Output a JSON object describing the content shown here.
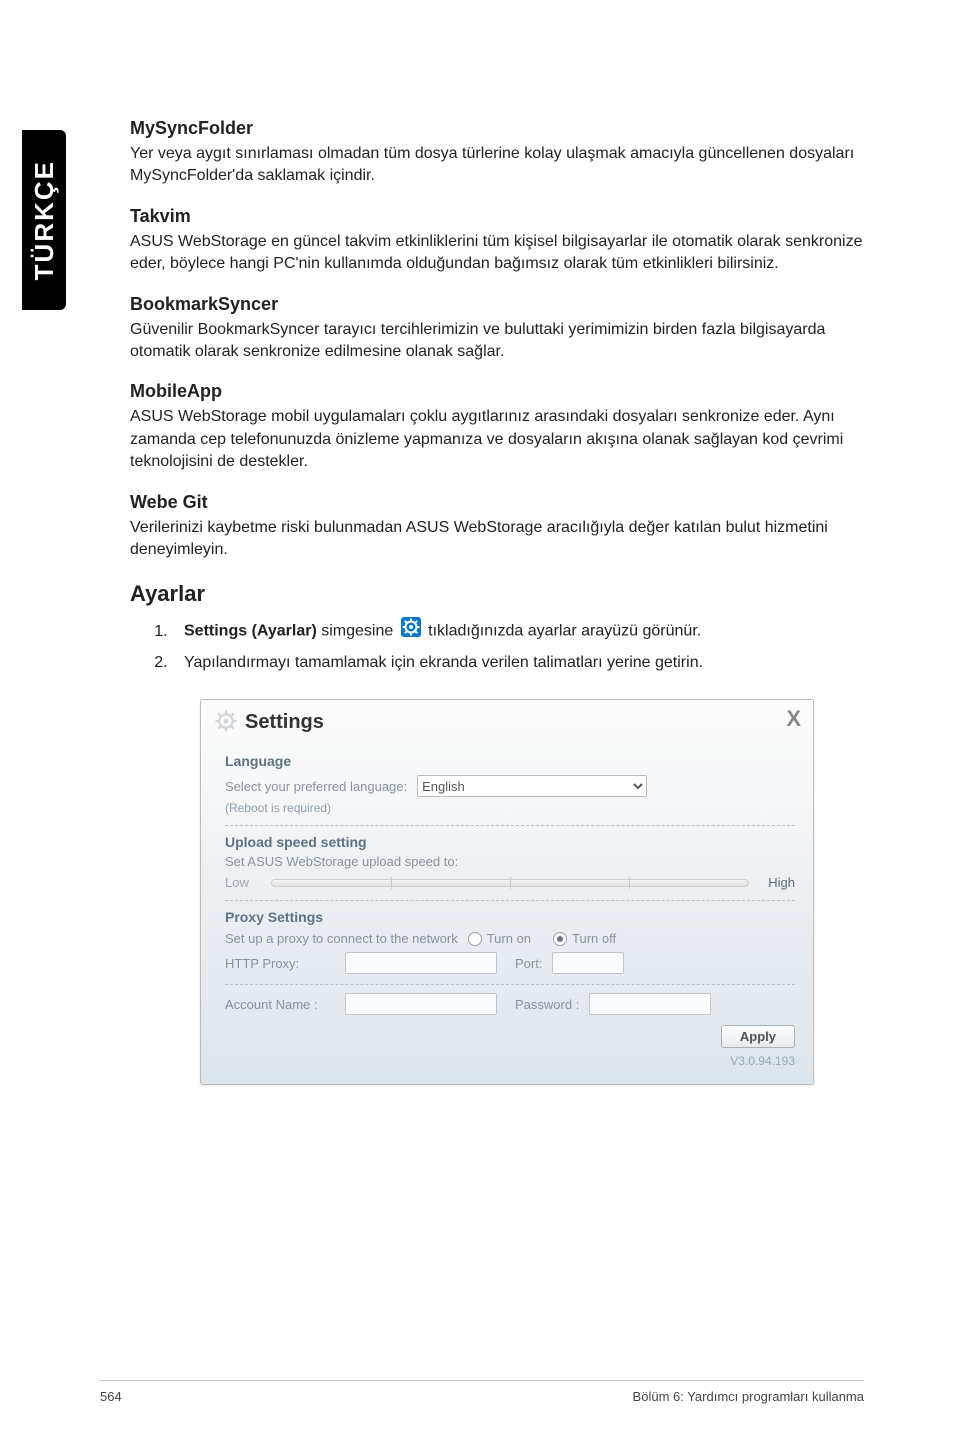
{
  "side_tab": "TÜRKÇE",
  "sections": {
    "mysyncfolder_title": "MySyncFolder",
    "mysyncfolder_body": "Yer veya aygıt sınırlaması olmadan tüm dosya türlerine kolay ulaşmak amacıyla güncellenen dosyaları MySyncFolder'da saklamak içindir.",
    "takvim_title": "Takvim",
    "takvim_body": "ASUS WebStorage en güncel takvim etkinliklerini tüm kişisel bilgisayarlar ile otomatik olarak senkronize eder, böylece hangi PC'nin kullanımda olduğundan bağımsız olarak tüm etkinlikleri bilirsiniz.",
    "bookmark_title": "BookmarkSyncer",
    "bookmark_body": "Güvenilir BookmarkSyncer tarayıcı tercihlerimizin ve buluttaki yerimimizin birden fazla bilgisayarda otomatik olarak senkronize edilmesine olanak sağlar.",
    "mobileapp_title": "MobileApp",
    "mobileapp_body": "ASUS WebStorage mobil uygulamaları çoklu aygıtlarınız arasındaki dosyaları senkronize eder. Aynı zamanda cep telefonunuzda önizleme yapmanıza ve dosyaların akışına olanak sağlayan kod çevrimi teknolojisini de destekler.",
    "webegit_title": "Webe Git",
    "webegit_body": "Verilerinizi kaybetme riski bulunmadan ASUS WebStorage aracılığıyla değer katılan bulut hizmetini deneyimleyin.",
    "ayarlar_title": "Ayarlar",
    "step1_prefix": "Settings (Ayarlar)",
    "step1_mid": " simgesine ",
    "step1_suffix": " tıkladığınızda ayarlar arayüzü görünür.",
    "step2": "Yapılandırmayı tamamlamak için ekranda verilen talimatları yerine getirin."
  },
  "dialog": {
    "title": "Settings",
    "close": "X",
    "language": {
      "title": "Language",
      "label": "Select your preferred language:",
      "value": "English",
      "note": "(Reboot is required)"
    },
    "upload": {
      "title": "Upload speed setting",
      "label": "Set ASUS WebStorage upload speed to:",
      "low": "Low",
      "high": "High"
    },
    "proxy": {
      "title": "Proxy Settings",
      "setup_label": "Set up a proxy to connect to the network",
      "turn_on": "Turn on",
      "turn_off": "Turn off",
      "http_proxy": "HTTP Proxy:",
      "port": "Port:",
      "account": "Account Name :",
      "password": "Password :"
    },
    "apply": "Apply",
    "version": "V3.0.94.193"
  },
  "footer": {
    "page": "564",
    "chapter": "Bölüm 6:  Yardımcı programları kullanma"
  }
}
